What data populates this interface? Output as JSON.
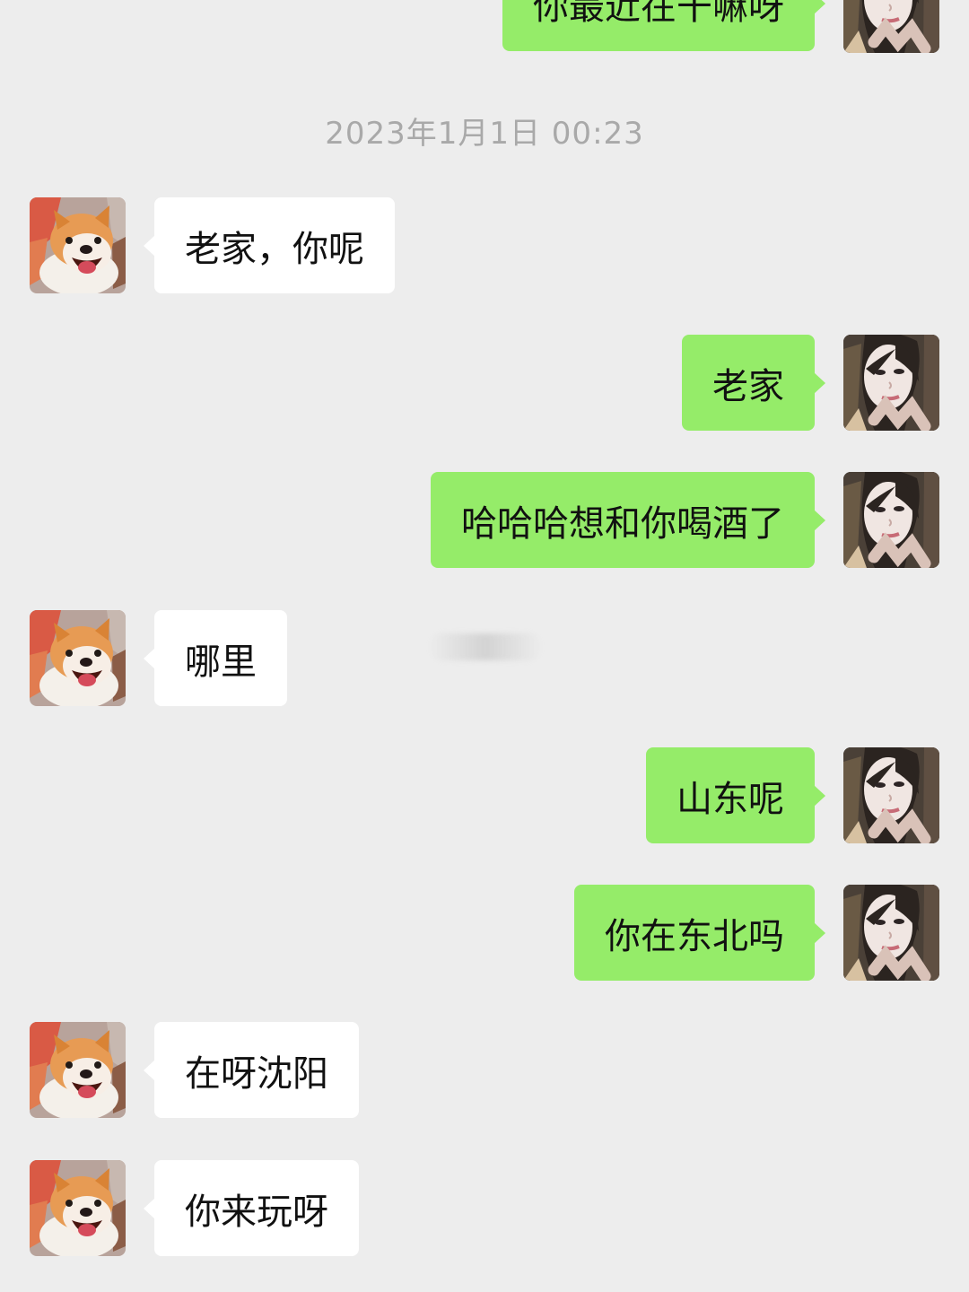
{
  "conversation": {
    "timestamp": "2023年1月1日 00:23",
    "messages": [
      {
        "side": "right",
        "text": "你最近在干嘛呀",
        "avatar": "woman-portrait-icon"
      },
      {
        "side": "left",
        "text": "老家，你呢",
        "avatar": "pomeranian-dog-icon"
      },
      {
        "side": "right",
        "text": "老家",
        "avatar": "woman-portrait-icon"
      },
      {
        "side": "right",
        "text": "哈哈哈想和你喝酒了",
        "avatar": "woman-portrait-icon"
      },
      {
        "side": "left",
        "text": "哪里",
        "avatar": "pomeranian-dog-icon"
      },
      {
        "side": "right",
        "text": "山东呢",
        "avatar": "woman-portrait-icon"
      },
      {
        "side": "right",
        "text": "你在东北吗",
        "avatar": "woman-portrait-icon"
      },
      {
        "side": "left",
        "text": "在呀沈阳",
        "avatar": "pomeranian-dog-icon"
      },
      {
        "side": "left",
        "text": "你来玩呀",
        "avatar": "pomeranian-dog-icon"
      }
    ]
  },
  "colors": {
    "background": "#ededed",
    "sent_bubble": "#95ec69",
    "received_bubble": "#ffffff",
    "timestamp_text": "#a9a9a9"
  }
}
